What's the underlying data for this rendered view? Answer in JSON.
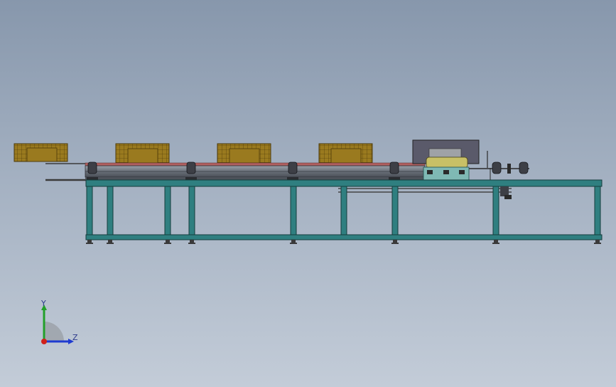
{
  "triad": {
    "y_label": "Y",
    "z_label": "Z",
    "y_color": "#22a02a",
    "z_color": "#1f3bd0",
    "x_color": "#d0201a"
  },
  "colors": {
    "frame": "#2f7f80",
    "frame_edge": "#143c3c",
    "crate": "#9a7a1f",
    "crate_edge": "#4b3808",
    "rail": "#6a707a",
    "dark_panel": "#5a5a6a",
    "machine_body": "#c8c066",
    "machine_base": "#7fb9b4"
  },
  "icons": {
    "triad": "axis-triad-icon"
  }
}
